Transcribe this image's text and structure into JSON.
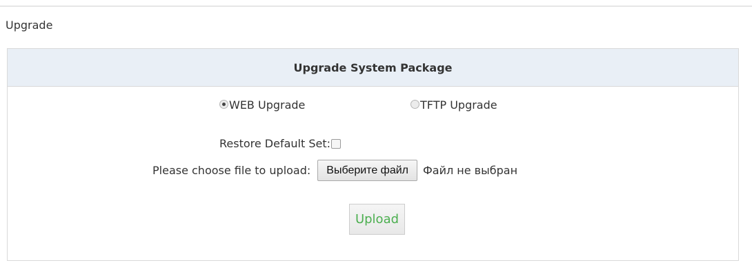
{
  "page": {
    "title": "Upgrade"
  },
  "panel": {
    "header": "Upgrade System Package",
    "upgrade_modes": [
      {
        "label": "WEB Upgrade",
        "selected": true
      },
      {
        "label": "TFTP Upgrade",
        "selected": false
      }
    ],
    "restore_default": {
      "label": "Restore Default Set:",
      "checked": false
    },
    "file_upload": {
      "label": "Please choose file to upload:",
      "button_label": "Выберите файл",
      "status": "Файл не выбран"
    },
    "upload_button": "Upload"
  },
  "colors": {
    "header_bg": "#e9eff6",
    "upload_text": "#4caf50",
    "border": "#d9d9d9"
  }
}
